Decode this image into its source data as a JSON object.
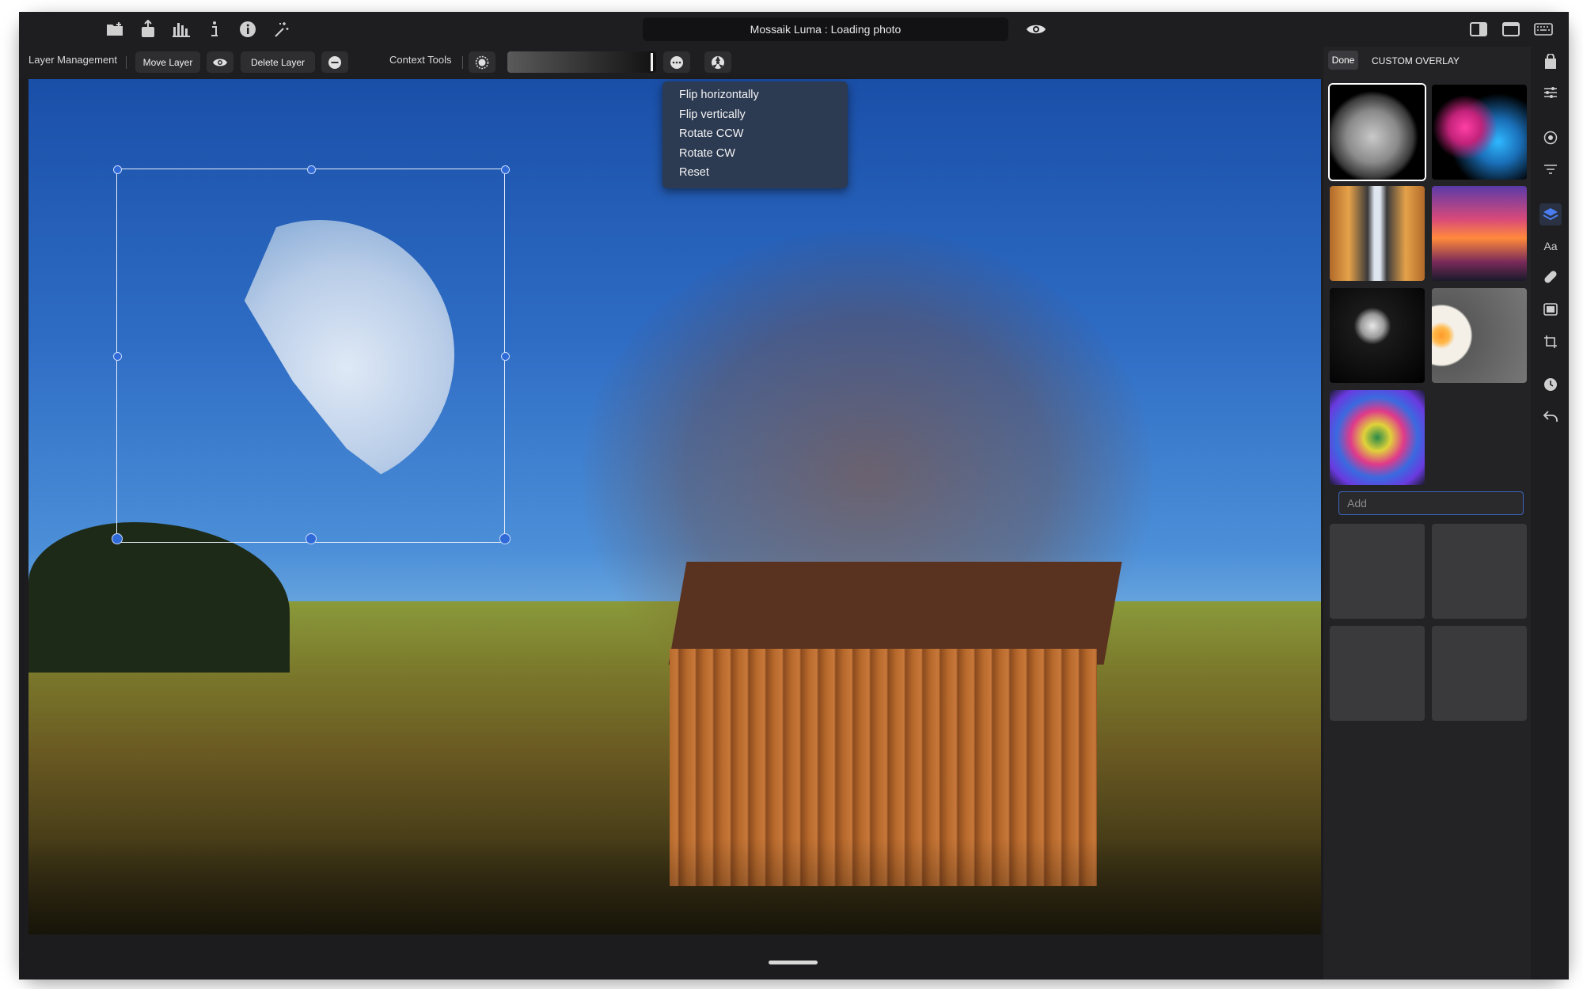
{
  "window": {
    "title": "Mossaik Luma : Loading photo"
  },
  "titlebar": {
    "left_icons": [
      "folder-add-icon",
      "share-icon",
      "histogram-icon",
      "info-text-icon",
      "info-circle-icon",
      "magic-wand-icon"
    ],
    "right_icons": [
      "eye-icon",
      "sidebar-toggle-icon",
      "window-icon",
      "keyboard-icon"
    ]
  },
  "toolbar": {
    "layer_management_label": "Layer Management",
    "move_layer_label": "Move Layer",
    "delete_layer_label": "Delete Layer",
    "context_tools_label": "Context Tools"
  },
  "context_menu": {
    "items": [
      "Flip horizontally",
      "Flip vertically",
      "Rotate CCW",
      "Rotate CW",
      "Reset"
    ]
  },
  "right_panel": {
    "done_label": "Done",
    "title": "CUSTOM OVERLAY",
    "add_placeholder": "Add",
    "thumbnails": [
      "moon",
      "paint-splash",
      "building-facade",
      "sunset-clouds",
      "dandelion",
      "fried-egg",
      "rainbow-rose"
    ],
    "selected_thumbnail": "moon"
  },
  "rail": {
    "icons": [
      "bag-icon",
      "sliders-icon",
      "target-icon",
      "filter-icon",
      "layers-icon",
      "text-icon",
      "bandage-icon",
      "frame-icon",
      "crop-icon",
      "history-icon",
      "undo-icon"
    ],
    "text_icon_label": "Aa",
    "active": "layers-icon"
  },
  "colors": {
    "accent": "#2f6ad8",
    "menu_background": "#2c3a52",
    "panel_background": "#232326"
  }
}
